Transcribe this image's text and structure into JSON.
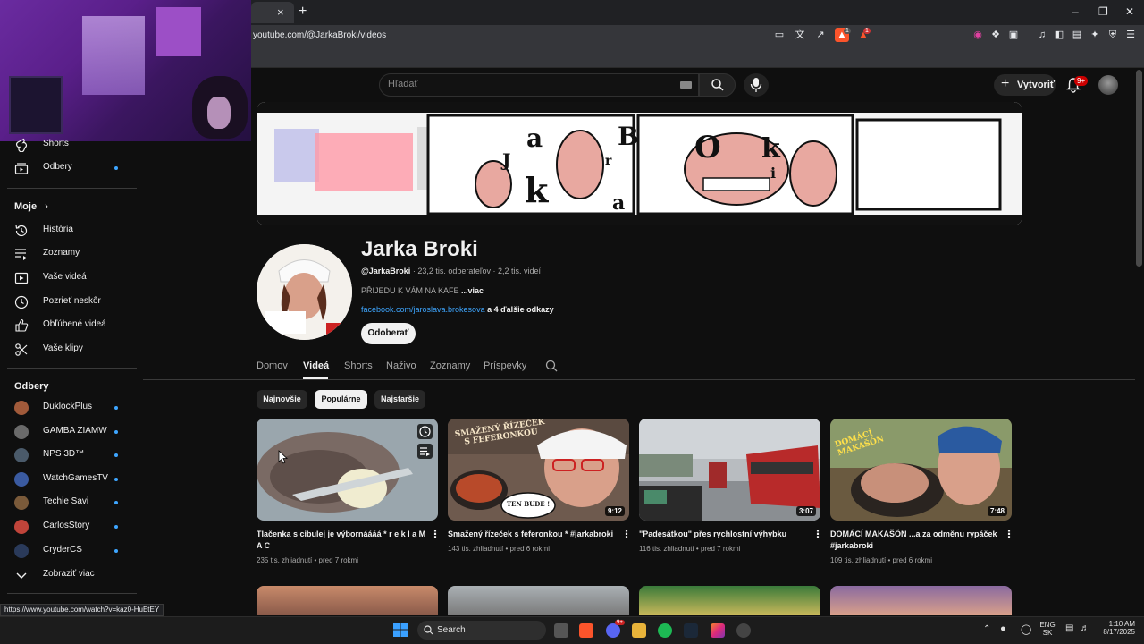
{
  "browser": {
    "url": "youtube.com/@JarkaBroki/videos",
    "tab_close": "×",
    "tab_new": "+",
    "status_url": "https://www.youtube.com/watch?v=kaz0-HuEtEY",
    "ext_badge_1": "1",
    "ext_badge_2": "1"
  },
  "masthead": {
    "search_placeholder": "Hľadať",
    "create_label": "Vytvoriť",
    "notifications_count": "9+"
  },
  "sidebar": {
    "top_items": [
      {
        "label": "Shorts"
      },
      {
        "label": "Odbery"
      }
    ],
    "moje_heading": "Moje",
    "moje_items": [
      {
        "label": "História"
      },
      {
        "label": "Zoznamy"
      },
      {
        "label": "Vaše videá"
      },
      {
        "label": "Pozrieť neskôr"
      },
      {
        "label": "Obľúbené videá"
      },
      {
        "label": "Vaše klipy"
      }
    ],
    "subs_heading": "Odbery",
    "subscriptions": [
      {
        "label": "DuklockPlus",
        "color": "#a15a3a"
      },
      {
        "label": "GAMBA ZIAMW",
        "color": "#6a6a6a"
      },
      {
        "label": "NPS 3D™",
        "color": "#4a5a6a"
      },
      {
        "label": "WatchGamesTV",
        "color": "#3a5aa0"
      },
      {
        "label": "Techie Savi",
        "color": "#7a5a3a"
      },
      {
        "label": "CarlosStory",
        "color": "#c0443a"
      },
      {
        "label": "CryderCS",
        "color": "#2a3a5a"
      }
    ],
    "show_more": "Zobraziť viac"
  },
  "channel": {
    "name": "Jarka Broki",
    "handle": "@JarkaBroki",
    "subscribers": "23,2 tis. odberateľov",
    "videos_count": "2,2 tis. videí",
    "description": "PŘIJEDU K VÁM NA KAFE",
    "more": "...viac",
    "link": "facebook.com/jaroslava.brokesova",
    "link_more": "a 4 ďalšie odkazy",
    "subscribe_label": "Odoberať"
  },
  "tabs": [
    {
      "label": "Domov",
      "active": false
    },
    {
      "label": "Videá",
      "active": true
    },
    {
      "label": "Shorts",
      "active": false
    },
    {
      "label": "Naživo",
      "active": false
    },
    {
      "label": "Zoznamy",
      "active": false
    },
    {
      "label": "Príspevky",
      "active": false
    }
  ],
  "chips": [
    {
      "label": "Najnovšie",
      "selected": false
    },
    {
      "label": "Populárne",
      "selected": true
    },
    {
      "label": "Najstaršie",
      "selected": false
    }
  ],
  "videos": [
    {
      "title": "Tlačenka s cibulej je výbornáááá * r e k l a M A C",
      "views": "235 tis. zhliadnutí",
      "age": "pred 7 rokmi",
      "duration": ""
    },
    {
      "title": "Smažený řízeček s feferonkou * #jarkabroki",
      "views": "143 tis. zhliadnutí",
      "age": "pred 6 rokmi",
      "duration": "9:12"
    },
    {
      "title": "\"Padesátkou\" přes rychlostní výhybku",
      "views": "116 tis. zhliadnutí",
      "age": "pred 7 rokmi",
      "duration": "3:07"
    },
    {
      "title": "DOMÁCÍ MAKAŠÓN ...a za odměnu rypáček #jarkabroki",
      "views": "109 tis. zhliadnutí",
      "age": "pred 6 rokmi",
      "duration": "7:48"
    }
  ],
  "thumb_text": {
    "v2_caption": "SMAŽENÝ ŘÍZEČEK S FEFERONKOU",
    "v2_bubble": "TEN BUDE !",
    "v4_caption": "DOMÁCÍ MAKAŠÓN"
  },
  "taskbar": {
    "search_label": "Search",
    "lang_1": "ENG",
    "lang_2": "SK",
    "time": "1:10 AM",
    "date": "8/17/2025",
    "discord_badge": "9+"
  },
  "colors": {
    "accent_link": "#3ea6ff",
    "brand_red": "#cc0000",
    "background": "#0f0f0f"
  }
}
